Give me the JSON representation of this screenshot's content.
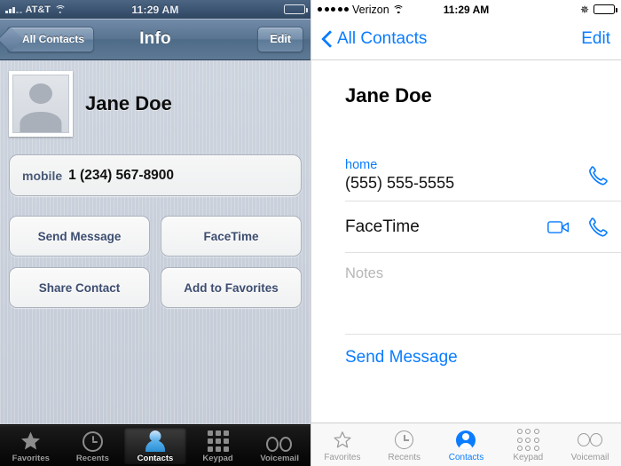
{
  "left": {
    "status": {
      "carrier": "AT&T",
      "time": "11:29 AM",
      "signal_icon": "signal-bars-icon",
      "wifi_icon": "wifi-icon",
      "battery_icon": "battery-icon"
    },
    "nav": {
      "back_label": "All Contacts",
      "title": "Info",
      "edit_label": "Edit"
    },
    "contact": {
      "name": "Jane Doe",
      "avatar_icon": "contact-placeholder-icon"
    },
    "phone": {
      "label": "mobile",
      "number": "1 (234) 567-8900"
    },
    "actions": [
      {
        "label": "Send Message"
      },
      {
        "label": "FaceTime"
      },
      {
        "label": "Share Contact"
      },
      {
        "label": "Add to Favorites"
      }
    ],
    "tabs": [
      {
        "label": "Favorites",
        "icon": "star-icon",
        "active": false
      },
      {
        "label": "Recents",
        "icon": "clock-icon",
        "active": false
      },
      {
        "label": "Contacts",
        "icon": "person-icon",
        "active": true
      },
      {
        "label": "Keypad",
        "icon": "keypad-icon",
        "active": false
      },
      {
        "label": "Voicemail",
        "icon": "voicemail-icon",
        "active": false
      }
    ]
  },
  "right": {
    "status": {
      "carrier": "Verizon",
      "time": "11:29 AM",
      "signal_icon": "signal-dots-icon",
      "wifi_icon": "wifi-icon",
      "bluetooth_icon": "bluetooth-icon",
      "battery_icon": "battery-icon"
    },
    "nav": {
      "back_label": "All Contacts",
      "edit_label": "Edit"
    },
    "contact": {
      "name": "Jane Doe"
    },
    "phone": {
      "label": "home",
      "number": "(555) 555-5555",
      "call_icon": "phone-icon"
    },
    "facetime": {
      "label": "FaceTime",
      "video_icon": "video-camera-icon",
      "audio_icon": "phone-icon"
    },
    "notes": {
      "placeholder": "Notes"
    },
    "send_message": {
      "label": "Send Message"
    },
    "tabs": [
      {
        "label": "Favorites",
        "icon": "star-icon",
        "active": false
      },
      {
        "label": "Recents",
        "icon": "clock-icon",
        "active": false
      },
      {
        "label": "Contacts",
        "icon": "person-icon",
        "active": true
      },
      {
        "label": "Keypad",
        "icon": "keypad-icon",
        "active": false
      },
      {
        "label": "Voicemail",
        "icon": "voicemail-icon",
        "active": false
      }
    ]
  },
  "colors": {
    "ios7_blue": "#0a7cff",
    "ios6_button_text": "#3c4d70",
    "ios6_bg": "#ccd2dc"
  }
}
